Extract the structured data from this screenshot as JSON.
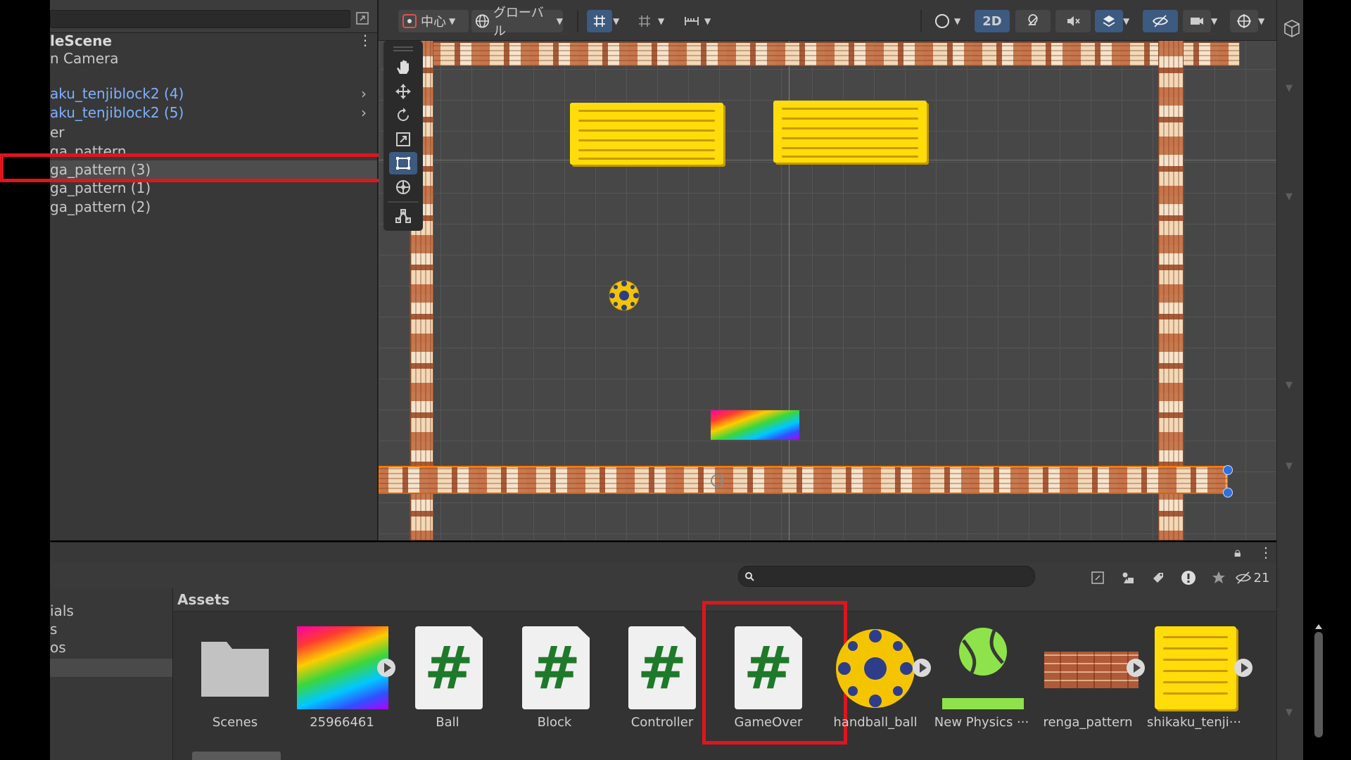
{
  "hierarchy": {
    "scene_title": "leScene",
    "items": [
      {
        "label": "n Camera",
        "prefab": false,
        "expandable": false
      },
      {
        "label": "aku_tenjiblock2 (4)",
        "prefab": true,
        "expandable": true
      },
      {
        "label": "aku_tenjiblock2 (5)",
        "prefab": true,
        "expandable": true
      },
      {
        "label": "er",
        "prefab": false,
        "expandable": false
      },
      {
        "label": "ga_pattern",
        "prefab": false,
        "expandable": false
      },
      {
        "label": "ga_pattern (3)",
        "prefab": false,
        "expandable": false,
        "selected": true
      },
      {
        "label": "ga_pattern (1)",
        "prefab": false,
        "expandable": false
      },
      {
        "label": "ga_pattern (2)",
        "prefab": false,
        "expandable": false
      }
    ]
  },
  "scene_toolbar": {
    "pivot_label": "中心",
    "space_label": "グローバル",
    "mode_2d": "2D"
  },
  "project": {
    "hidden_count": "21",
    "folders": [
      "ials",
      "s",
      "os"
    ],
    "assets_title": "Assets",
    "assets": [
      {
        "name": "Scenes",
        "kind": "folder"
      },
      {
        "name": "25966461",
        "kind": "image"
      },
      {
        "name": "Ball",
        "kind": "script"
      },
      {
        "name": "Block",
        "kind": "script"
      },
      {
        "name": "Controller",
        "kind": "script"
      },
      {
        "name": "GameOver",
        "kind": "script",
        "highlighted": true
      },
      {
        "name": "handball_ball",
        "kind": "sprite"
      },
      {
        "name": "New Physics ···",
        "kind": "physics-material"
      },
      {
        "name": "renga_pattern",
        "kind": "sprite"
      },
      {
        "name": "shikaku_tenji···",
        "kind": "sprite"
      }
    ]
  },
  "colors": {
    "highlight": "#e0141e",
    "prefab_text": "#7fb0ff",
    "accent_active": "#3d5a80",
    "script_hash": "#1e7a2a"
  },
  "icons": [
    "maximize-icon",
    "kebab-menu-icon",
    "hand-tool-icon",
    "move-tool-icon",
    "rotate-tool-icon",
    "scale-tool-icon",
    "rect-tool-icon",
    "transform-tool-icon",
    "custom-tool-icon",
    "search-icon",
    "lock-icon",
    "star-icon",
    "hidden-eye-icon"
  ]
}
